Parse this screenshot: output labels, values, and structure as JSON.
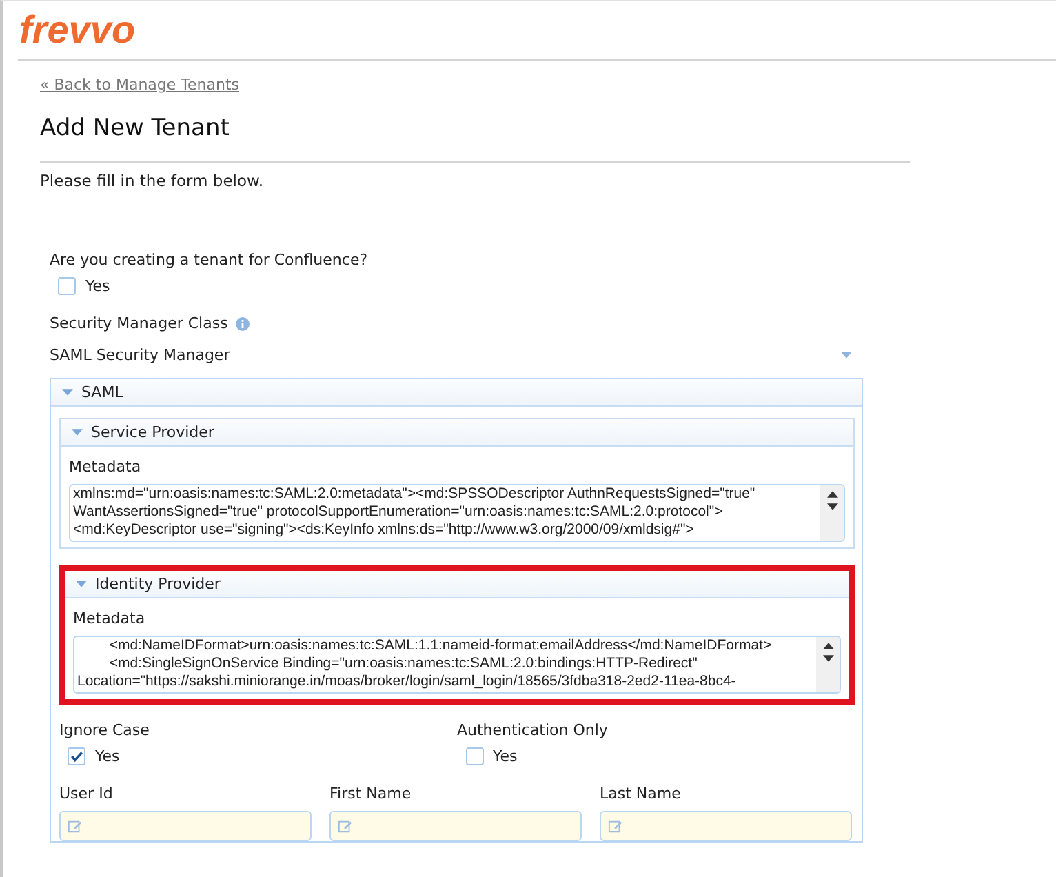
{
  "logo": {
    "text": "frevvo"
  },
  "back_link": "« Back to Manage Tenants",
  "title": "Add New Tenant",
  "intro": "Please fill in the form below.",
  "confluence": {
    "question": "Are you creating a tenant for Confluence?",
    "option": "Yes",
    "checked": false
  },
  "security_manager": {
    "label": "Security Manager Class",
    "value": "SAML Security Manager"
  },
  "saml": {
    "title": "SAML",
    "expanded": true,
    "sections": [
      {
        "title": "Service Provider",
        "expanded": true,
        "highlighted": false,
        "field_label": "Metadata",
        "lines": [
          "xmlns:md=\"urn:oasis:names:tc:SAML:2.0:metadata\"><md:SPSSODescriptor AuthnRequestsSigned=\"true\"",
          "WantAssertionsSigned=\"true\" protocolSupportEnumeration=\"urn:oasis:names:tc:SAML:2.0:protocol\">",
          "<md:KeyDescriptor use=\"signing\"><ds:KeyInfo xmlns:ds=\"http://www.w3.org/2000/09/xmldsig#\">"
        ]
      },
      {
        "title": "Identity Provider",
        "expanded": true,
        "highlighted": true,
        "field_label": "Metadata",
        "lines": [
          "        <md:NameIDFormat>urn:oasis:names:tc:SAML:1.1:nameid-format:emailAddress</md:NameIDFormat>",
          "        <md:SingleSignOnService Binding=\"urn:oasis:names:tc:SAML:2.0:bindings:HTTP-Redirect\"",
          "Location=\"https://sakshi.miniorange.in/moas/broker/login/saml_login/18565/3fdba318-2ed2-11ea-8bc4-"
        ]
      }
    ],
    "options": [
      {
        "label": "Ignore Case",
        "option": "Yes",
        "checked": true
      },
      {
        "label": "Authentication Only",
        "option": "Yes",
        "checked": false
      }
    ],
    "fields": [
      {
        "label": "User Id"
      },
      {
        "label": "First Name"
      },
      {
        "label": "Last Name"
      }
    ]
  }
}
